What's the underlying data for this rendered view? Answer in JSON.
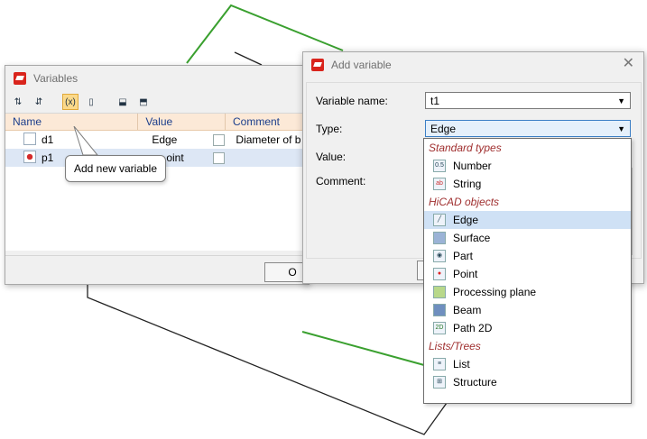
{
  "variables_window": {
    "title": "Variables",
    "toolbar_icons": [
      "sort-asc-icon",
      "sort-desc-icon",
      "add-variable-icon",
      "copy-icon",
      "import-icon",
      "export-icon"
    ],
    "columns": [
      "Name",
      "Value",
      "Comment"
    ],
    "rows": [
      {
        "name": "d1",
        "value": "Edge",
        "comment": "Diameter of b",
        "icon": "edge-icon"
      },
      {
        "name": "p1",
        "value": "oint",
        "comment": "",
        "icon": "point-icon"
      }
    ],
    "ok_label": "O"
  },
  "tooltip": {
    "text": "Add new variable"
  },
  "add_variable_dialog": {
    "title": "Add variable",
    "variable_name_label": "Variable name:",
    "variable_name_value": "t1",
    "type_label": "Type:",
    "type_value": "Edge",
    "value_label": "Value:",
    "comment_label": "Comment:"
  },
  "type_dropdown": {
    "categories": [
      {
        "label": "Standard types",
        "items": [
          {
            "label": "Number",
            "icon": "number-icon"
          },
          {
            "label": "String",
            "icon": "string-icon"
          }
        ]
      },
      {
        "label": "HiCAD objects",
        "items": [
          {
            "label": "Edge",
            "icon": "edge-icon",
            "selected": true
          },
          {
            "label": "Surface",
            "icon": "surface-icon"
          },
          {
            "label": "Part",
            "icon": "part-icon"
          },
          {
            "label": "Point",
            "icon": "point-icon"
          },
          {
            "label": "Processing plane",
            "icon": "processing-plane-icon"
          },
          {
            "label": "Beam",
            "icon": "beam-icon"
          },
          {
            "label": "Path 2D",
            "icon": "path-2d-icon"
          }
        ]
      },
      {
        "label": "Lists/Trees",
        "items": [
          {
            "label": "List",
            "icon": "list-icon"
          },
          {
            "label": "Structure",
            "icon": "structure-icon"
          }
        ]
      }
    ]
  },
  "colors": {
    "accent_line": "#3aa02f",
    "category_text": "#a03030",
    "selection": "#cfe1f5",
    "header_bg": "#fce9d7"
  }
}
